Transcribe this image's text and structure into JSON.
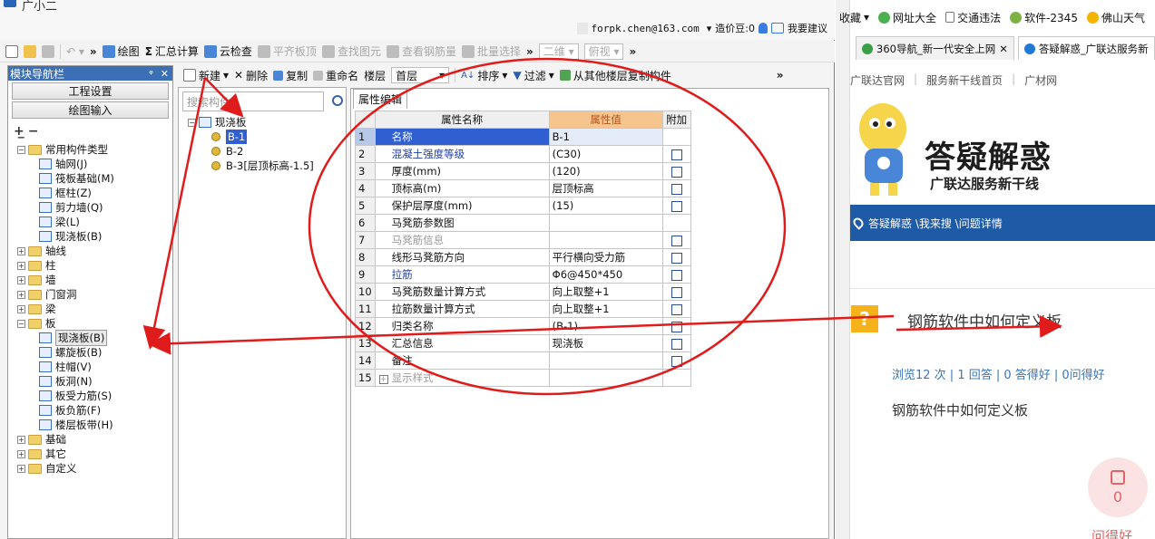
{
  "app": {
    "title": "广小二",
    "user_email": "forpk.chen@163.com",
    "cost_beans": "造价豆:0",
    "suggest": "我要建议"
  },
  "toolbar1": {
    "items": [
      {
        "label": "绘图",
        "enabled": true,
        "icon": "draw-icon"
      },
      {
        "label": "汇总计算",
        "enabled": true,
        "icon": "sigma-icon"
      },
      {
        "label": "云检查",
        "enabled": true,
        "icon": "cloud-check-icon"
      },
      {
        "label": "平齐板顶",
        "enabled": false,
        "icon": "flush-icon"
      },
      {
        "label": "查找图元",
        "enabled": false,
        "icon": "find-icon"
      },
      {
        "label": "查看钢筋量",
        "enabled": false,
        "icon": "rebar-icon"
      },
      {
        "label": "批量选择",
        "enabled": false,
        "icon": "batch-icon"
      }
    ],
    "view_mode": "二维",
    "view_angle": "俯视"
  },
  "nav": {
    "header": "模块导航栏",
    "btn_project": "工程设置",
    "btn_draw": "绘图输入",
    "tree": [
      {
        "label": "常用构件类型",
        "level": 0,
        "kind": "folder",
        "expanded": true
      },
      {
        "label": "轴网(J)",
        "level": 1,
        "kind": "leaf"
      },
      {
        "label": "筏板基础(M)",
        "level": 1,
        "kind": "leaf"
      },
      {
        "label": "框柱(Z)",
        "level": 1,
        "kind": "leaf"
      },
      {
        "label": "剪力墙(Q)",
        "level": 1,
        "kind": "leaf"
      },
      {
        "label": "梁(L)",
        "level": 1,
        "kind": "leaf"
      },
      {
        "label": "现浇板(B)",
        "level": 1,
        "kind": "leaf"
      },
      {
        "label": "轴线",
        "level": 0,
        "kind": "folder",
        "expanded": false
      },
      {
        "label": "柱",
        "level": 0,
        "kind": "folder",
        "expanded": false
      },
      {
        "label": "墙",
        "level": 0,
        "kind": "folder",
        "expanded": false
      },
      {
        "label": "门窗洞",
        "level": 0,
        "kind": "folder",
        "expanded": false
      },
      {
        "label": "梁",
        "level": 0,
        "kind": "folder",
        "expanded": false
      },
      {
        "label": "板",
        "level": 0,
        "kind": "folder",
        "expanded": true
      },
      {
        "label": "现浇板(B)",
        "level": 1,
        "kind": "leaf",
        "selected": true
      },
      {
        "label": "螺旋板(B)",
        "level": 1,
        "kind": "leaf"
      },
      {
        "label": "柱帽(V)",
        "level": 1,
        "kind": "leaf"
      },
      {
        "label": "板洞(N)",
        "level": 1,
        "kind": "leaf"
      },
      {
        "label": "板受力筋(S)",
        "level": 1,
        "kind": "leaf"
      },
      {
        "label": "板负筋(F)",
        "level": 1,
        "kind": "leaf"
      },
      {
        "label": "楼层板带(H)",
        "level": 1,
        "kind": "leaf"
      },
      {
        "label": "基础",
        "level": 0,
        "kind": "folder",
        "expanded": false
      },
      {
        "label": "其它",
        "level": 0,
        "kind": "folder",
        "expanded": false
      },
      {
        "label": "自定义",
        "level": 0,
        "kind": "folder",
        "expanded": false
      }
    ]
  },
  "toolbar2": {
    "new": "新建",
    "delete": "删除",
    "copy": "复制",
    "rename": "重命名",
    "floor_label": "楼层",
    "floor_value": "首层",
    "sort": "排序",
    "filter": "过滤",
    "copy_from": "从其他楼层复制构件"
  },
  "components": {
    "search_placeholder": "搜索构件...",
    "root": "现浇板",
    "items": [
      {
        "label": "B-1",
        "selected": true
      },
      {
        "label": "B-2",
        "selected": false
      },
      {
        "label": "B-3[层顶标高-1.5]",
        "selected": false
      }
    ]
  },
  "props": {
    "tab": "属性编辑",
    "headers": [
      "属性名称",
      "属性值",
      "附加"
    ],
    "rows": [
      {
        "num": "1",
        "name": "名称",
        "value": "B-1",
        "style": "normal",
        "check": false
      },
      {
        "num": "2",
        "name": "混凝土强度等级",
        "value": "(C30)",
        "style": "blue",
        "check": true
      },
      {
        "num": "3",
        "name": "厚度(mm)",
        "value": "(120)",
        "style": "normal",
        "check": true
      },
      {
        "num": "4",
        "name": "顶标高(m)",
        "value": "层顶标高",
        "style": "normal",
        "check": true
      },
      {
        "num": "5",
        "name": "保护层厚度(mm)",
        "value": "(15)",
        "style": "normal",
        "check": true
      },
      {
        "num": "6",
        "name": "马凳筋参数图",
        "value": "",
        "style": "normal",
        "check": false
      },
      {
        "num": "7",
        "name": "马凳筋信息",
        "value": "",
        "style": "gray",
        "check": true
      },
      {
        "num": "8",
        "name": "线形马凳筋方向",
        "value": "平行横向受力筋",
        "style": "normal",
        "check": true
      },
      {
        "num": "9",
        "name": "拉筋",
        "value": "Φ6@450*450",
        "style": "blue",
        "check": true
      },
      {
        "num": "10",
        "name": "马凳筋数量计算方式",
        "value": "向上取整+1",
        "style": "normal",
        "check": true
      },
      {
        "num": "11",
        "name": "拉筋数量计算方式",
        "value": "向上取整+1",
        "style": "normal",
        "check": true
      },
      {
        "num": "12",
        "name": "归类名称",
        "value": "(B-1)",
        "style": "normal",
        "check": true
      },
      {
        "num": "13",
        "name": "汇总信息",
        "value": "现浇板",
        "style": "normal",
        "check": true
      },
      {
        "num": "14",
        "name": "备注",
        "value": "",
        "style": "normal",
        "check": true
      },
      {
        "num": "15",
        "name": "显示样式",
        "value": "",
        "style": "gray-expand",
        "check": false
      }
    ]
  },
  "browser": {
    "bookmarks": [
      "收藏",
      "网址大全",
      "交通违法",
      "软件-2345",
      "佛山天气"
    ],
    "tabs": [
      "360导航_新一代安全上网",
      "答疑解惑_广联达服务新"
    ],
    "sublinks": [
      "广联达官网",
      "服务新干线首页",
      "广材网"
    ],
    "banner_title": "答疑解惑",
    "banner_sub": "广联达服务新干线",
    "breadcrumb": "答疑解惑 \\我来搜 \\问题详情",
    "question_title": "钢筋软件中如何定义板",
    "stats": "浏览12 次 | 1 回答 | 0 答得好 | 0问得好",
    "question_body": "钢筋软件中如何定义板",
    "like_count": "0",
    "good_label": "问得好"
  },
  "colors": {
    "nav_header": "#3b6fb6",
    "selection": "#2f5fd0",
    "value_header": "#f6c58d",
    "annotation": "#e01b1b",
    "brand_blue": "#1f5aa6"
  }
}
